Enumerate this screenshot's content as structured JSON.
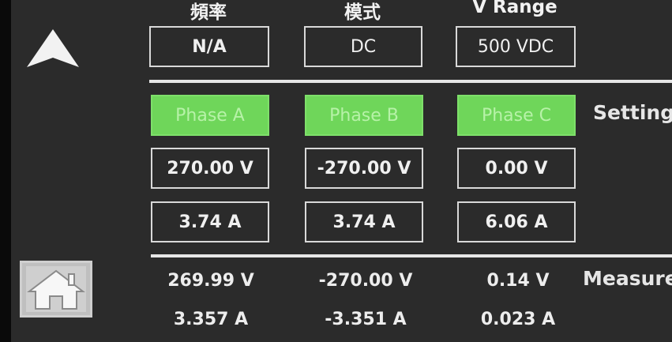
{
  "header": {
    "frequency_label": "頻率",
    "mode_label": "模式",
    "vrange_label": "V Range"
  },
  "top_fields": {
    "frequency_value": "N/A",
    "mode_value": "DC",
    "vrange_value": "500 VDC"
  },
  "phases": [
    "Phase A",
    "Phase B",
    "Phase C"
  ],
  "labels": {
    "setting": "Setting",
    "measure": "Measure"
  },
  "setting": {
    "voltage": [
      "270.00 V",
      "-270.00 V",
      "0.00 V"
    ],
    "current": [
      "3.74 A",
      "3.74 A",
      "6.06 A"
    ]
  },
  "measure": {
    "voltage": [
      "269.99 V",
      "-270.00 V",
      "0.14 V"
    ],
    "current": [
      "3.357 A",
      "-3.351 A",
      "0.023 A"
    ]
  },
  "icons": {
    "up": "up-arrow-icon",
    "home": "home-icon"
  },
  "colors": {
    "background": "#2b2b2b",
    "phase_button": "#6fd65a",
    "phase_text": "#b7f2a8",
    "text": "#f0f0f0"
  }
}
